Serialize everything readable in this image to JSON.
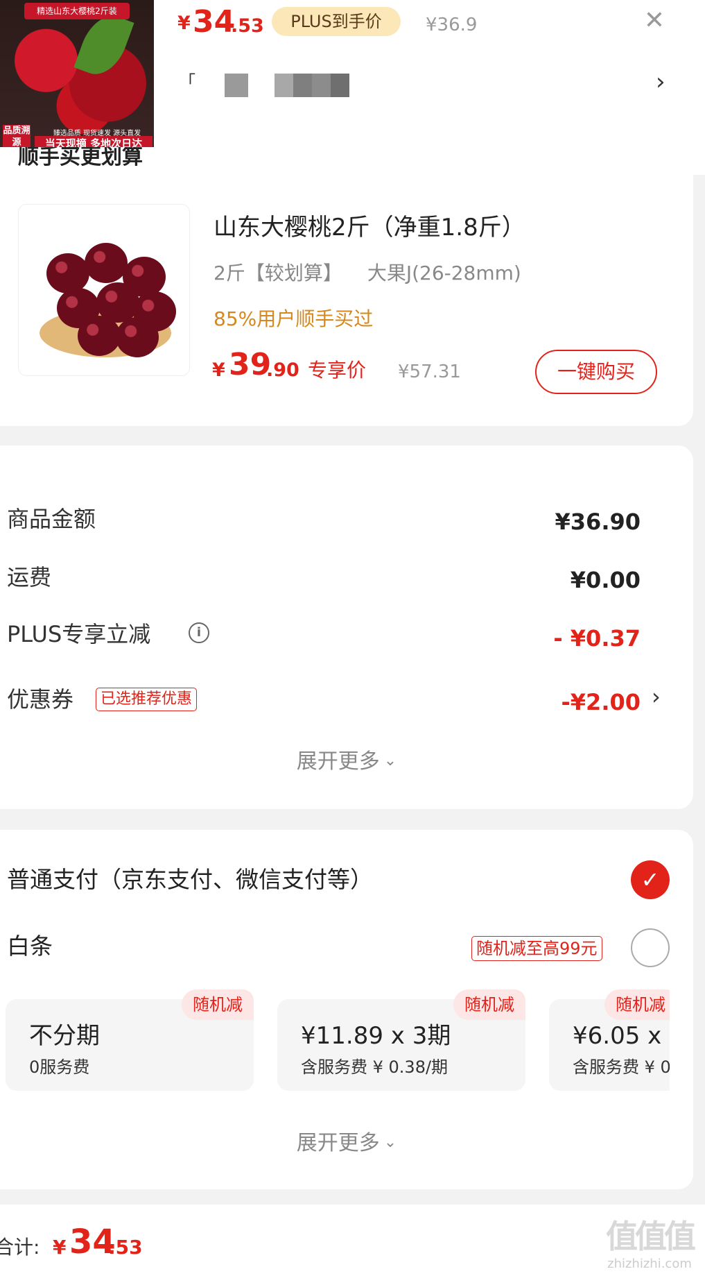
{
  "header": {
    "thumb": {
      "top_caption": "精选山东大樱桃2斤装",
      "left_caption": "品质溯源",
      "mid_caption": "臻选品质 现货速发 源头直发",
      "bottom_caption": "当天现摘 多地次日达"
    },
    "price_yen": "¥",
    "price_int": "34",
    "price_dec": ".53",
    "plus_badge": "PLUS到手价",
    "orig_price": "¥36.9",
    "spec_bracket": "「",
    "close_icon": "close-icon",
    "chevron_icon": "chevron-right-icon"
  },
  "recommend": {
    "title": "顺手买更划算",
    "name": "山东大樱桃2斤（净重1.8斤）",
    "spec1": "2斤【较划算】",
    "spec2": "大果J(26-28mm)",
    "bought": "85%用户顺手买过",
    "price_yen": "¥",
    "price_int": "39",
    "price_dec": ".90",
    "price_tag": "专享价",
    "orig_price": "¥57.31",
    "buy_button": "一键购买"
  },
  "summary": {
    "rows": [
      {
        "label": "商品金额",
        "value": "¥36.90"
      },
      {
        "label": "运费",
        "value": "¥0.00"
      },
      {
        "label": "PLUS专享立减",
        "value": "- ¥0.37"
      },
      {
        "label": "优惠券",
        "value": "-¥2.00"
      }
    ],
    "coupon_tag": "已选推荐优惠",
    "expand": "展开更多",
    "info_icon": "info-icon"
  },
  "payment": {
    "normal_pay": "普通支付（京东支付、微信支付等）",
    "baitiao": "白条",
    "baitiao_tag": "随机减至高99元",
    "installments": [
      {
        "badge": "随机减",
        "main": "不分期",
        "sub": "0服务费"
      },
      {
        "badge": "随机减",
        "main": "¥11.89 x 3期",
        "sub": "含服务费 ¥ 0.38/期"
      },
      {
        "badge": "随机减",
        "main": "¥6.05 x",
        "sub": "含服务费 ¥ 0"
      }
    ],
    "expand": "展开更多"
  },
  "footer": {
    "total_label": "合计:",
    "total_yen": "¥",
    "total_int": "34",
    "total_dec": ".53",
    "watermark_big": "值值值",
    "watermark_small": "zhizhizhi.com"
  },
  "colors": {
    "accent_red": "#e2231a",
    "plus_gold": "#fbe7b7",
    "bought_orange": "#d4881f",
    "background": "#f2f2f2"
  }
}
